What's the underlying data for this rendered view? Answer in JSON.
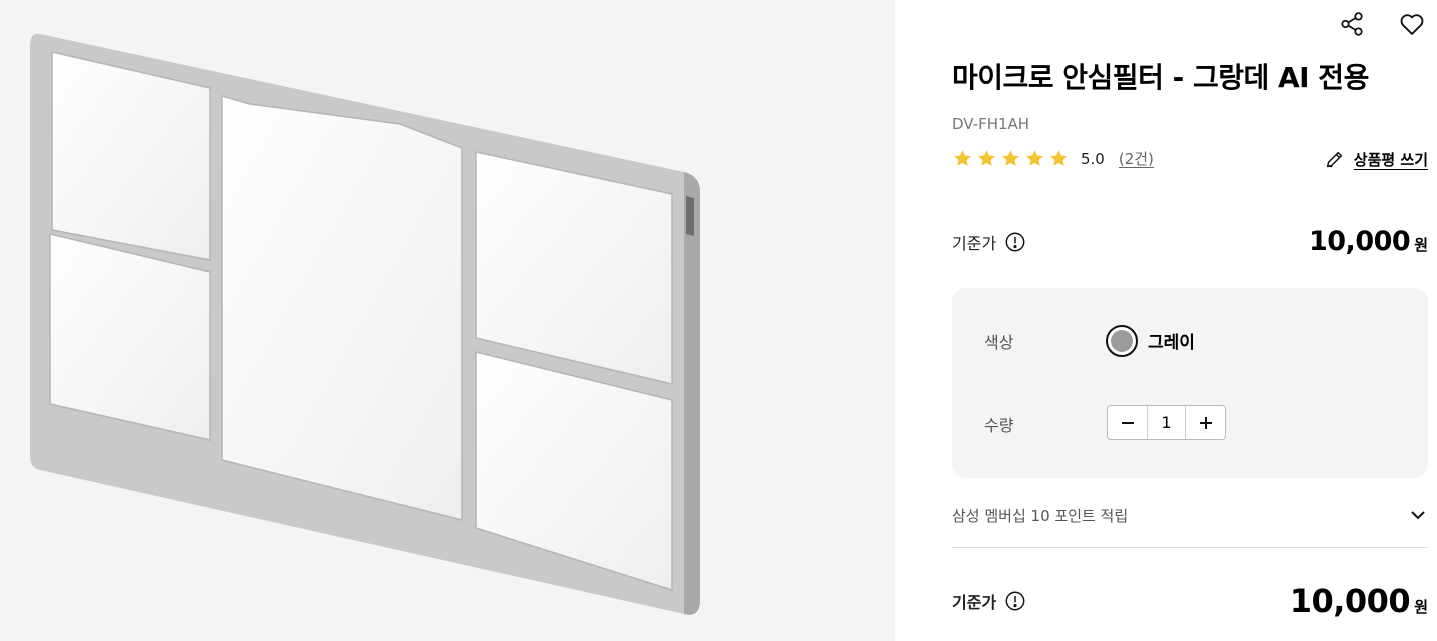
{
  "header": {
    "share_icon": "share-icon",
    "wishlist_icon": "heart-icon"
  },
  "product": {
    "title": "마이크로 안심필터 - 그랑데 AI 전용",
    "model": "DV-FH1AH",
    "rating": {
      "score": "5.0",
      "stars": 5,
      "max_stars": 5,
      "count": "(2건)",
      "star_color": "#f5c330"
    },
    "write_review_label": "상품평 쓰기"
  },
  "price": {
    "label": "기준가",
    "value": "10,000",
    "unit": "원"
  },
  "options": {
    "color_label": "색상",
    "color_name": "그레이",
    "swatch_color": "#9b9b9b",
    "quantity_label": "수량",
    "quantity": "1"
  },
  "points": {
    "text": "삼성 멤버십 10 포인트 적립"
  },
  "total": {
    "label": "기준가",
    "value": "10,000",
    "unit": "원"
  }
}
